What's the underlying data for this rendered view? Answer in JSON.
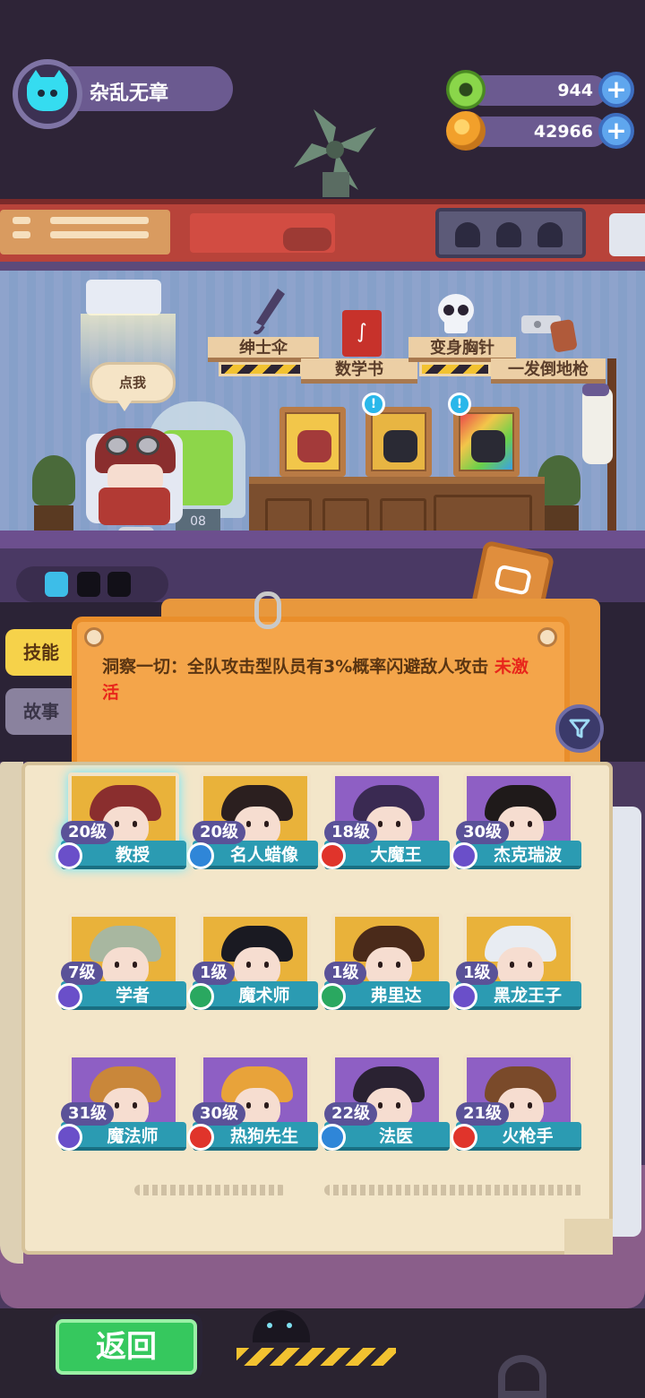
{
  "player": {
    "name": "杂乱无章",
    "avatar_icon": "cyan-cat-icon"
  },
  "currencies": [
    {
      "name": "green-gem",
      "value": "944",
      "icon": "green-donut-icon",
      "color": "#6cc234"
    },
    {
      "name": "gold-coin",
      "value": "42966",
      "icon": "orange-planet-icon",
      "color": "#f2a02b"
    }
  ],
  "room": {
    "speech": "点我",
    "items": [
      {
        "label": "绅士伞",
        "icon": "umbrella-icon"
      },
      {
        "label": "数学书",
        "icon": "book-icon"
      },
      {
        "label": "变身胸针",
        "icon": "skull-icon"
      },
      {
        "label": "一发倒地枪",
        "icon": "pistol-icon"
      }
    ],
    "counter": "08"
  },
  "tabs": {
    "skill": "技能",
    "story": "故事"
  },
  "skill": {
    "text": "洞察一切：全队攻击型队员有3%概率闪避敌人攻击",
    "status": "未激活"
  },
  "roster": [
    {
      "level": "20级",
      "name": "教授",
      "class_color": "#6a4fc9",
      "class_icon": "purple-hex-icon",
      "bg": "#e9b23a",
      "hair": "#8a2e2e",
      "selected": true
    },
    {
      "level": "20级",
      "name": "名人蜡像",
      "class_color": "#2f86d8",
      "class_icon": "blue-shield-icon",
      "bg": "#e9b23a",
      "hair": "#2b1f1f"
    },
    {
      "level": "18级",
      "name": "大魔王",
      "class_color": "#e0342b",
      "class_icon": "red-shield-icon",
      "bg": "#8e5fc4",
      "hair": "#3a2a52"
    },
    {
      "level": "30级",
      "name": "杰克瑞波",
      "class_color": "#6a4fc9",
      "class_icon": "purple-hex-icon",
      "bg": "#8e5fc4",
      "hair": "#1f1a1a"
    },
    {
      "level": "7级",
      "name": "学者",
      "class_color": "#6a4fc9",
      "class_icon": "purple-hex-icon",
      "bg": "#e9b23a",
      "hair": "#a8b7a0"
    },
    {
      "level": "1级",
      "name": "魔术师",
      "class_color": "#2aa860",
      "class_icon": "green-hex-icon",
      "bg": "#e9b23a",
      "hair": "#1a1a22"
    },
    {
      "level": "1级",
      "name": "弗里达",
      "class_color": "#2aa860",
      "class_icon": "green-hex-icon",
      "bg": "#e9b23a",
      "hair": "#4a2a1a"
    },
    {
      "level": "1级",
      "name": "黑龙王子",
      "class_color": "#6a4fc9",
      "class_icon": "purple-shield-icon",
      "bg": "#e9b23a",
      "hair": "#e8ecf2"
    },
    {
      "level": "31级",
      "name": "魔法师",
      "class_color": "#6a4fc9",
      "class_icon": "purple-hex-icon",
      "bg": "#8e5fc4",
      "hair": "#c9873a"
    },
    {
      "level": "30级",
      "name": "热狗先生",
      "class_color": "#e0342b",
      "class_icon": "red-shield-icon",
      "bg": "#8e5fc4",
      "hair": "#e8a33a"
    },
    {
      "level": "22级",
      "name": "法医",
      "class_color": "#2f86d8",
      "class_icon": "blue-hex-icon",
      "bg": "#8e5fc4",
      "hair": "#2a2232"
    },
    {
      "level": "21级",
      "name": "火枪手",
      "class_color": "#e0342b",
      "class_icon": "red-hex-icon",
      "bg": "#8e5fc4",
      "hair": "#7a4a2a"
    }
  ],
  "footer": {
    "back": "返回"
  }
}
